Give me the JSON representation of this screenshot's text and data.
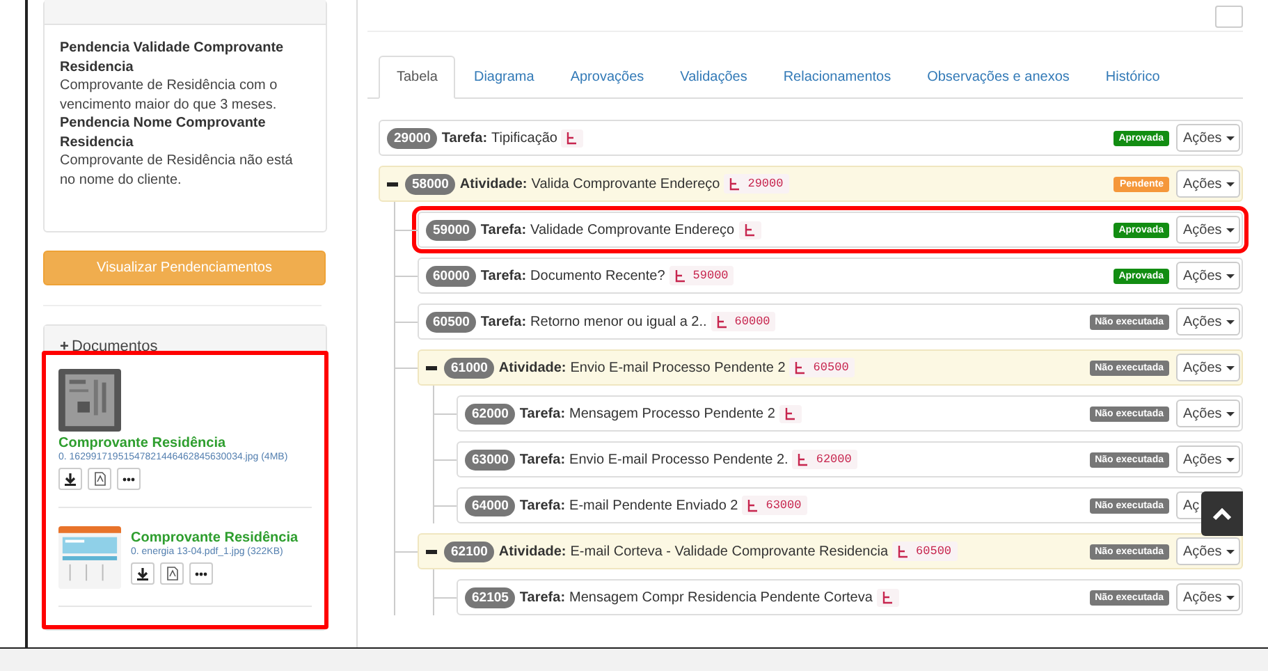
{
  "pendencias": {
    "items": [
      {
        "title": "Pendencia Validade Comprovante Residencia",
        "text": "Comprovante de Residência com o vencimento maior do que 3 meses."
      },
      {
        "title": "Pendencia Nome Comprovante Residencia",
        "text": "Comprovante de Residência não está no nome do cliente."
      }
    ],
    "button": "Visualizar Pendenciamentos"
  },
  "documentos": {
    "toggle": "+",
    "title": "Documentos",
    "highlighted": true,
    "items": [
      {
        "kind": "picture",
        "title": "Comprovante Residência",
        "file": "0. 16299171951547821446462845630034.jpg (4MB)"
      },
      {
        "kind": "picture",
        "title": "Comprovante Residência",
        "file": "0. energia 13-04.pdf_1.jpg (322KB)"
      }
    ]
  },
  "tabs": [
    {
      "label": "Tabela",
      "selected": true
    },
    {
      "label": "Diagrama",
      "selected": false
    },
    {
      "label": "Aprovações",
      "selected": false
    },
    {
      "label": "Validações",
      "selected": false
    },
    {
      "label": "Relacionamentos",
      "selected": false
    },
    {
      "label": "Observações e anexos",
      "selected": false
    },
    {
      "label": "Histórico",
      "selected": false
    }
  ],
  "tree": [
    {
      "kind": "task",
      "id": "29000",
      "type": "Tarefa:",
      "name": "Tipificação",
      "status": "Aprovada",
      "color": "#128d12",
      "actions": "Ações"
    },
    {
      "kind": "activity",
      "id": "58000",
      "type": "Atividade:",
      "name": "Valida Comprovante Endereço",
      "dep": "29000",
      "status": "Pendente",
      "color": "#f5973a",
      "actions": "Ações",
      "expanded": true,
      "children": [
        {
          "kind": "task",
          "id": "59000",
          "type": "Tarefa:",
          "name": "Validade Comprovante Endereço",
          "status": "Aprovada",
          "color": "#128d12",
          "actions": "Ações",
          "highlighted": true
        },
        {
          "kind": "task",
          "id": "60000",
          "type": "Tarefa:",
          "name": "Documento Recente?",
          "dep": "59000",
          "status": "Aprovada",
          "color": "#128d12",
          "actions": "Ações"
        },
        {
          "kind": "task",
          "id": "60500",
          "type": "Tarefa:",
          "name": "Retorno menor ou igual a 2..",
          "dep": "60000",
          "status": "Não executada",
          "color": "#777777",
          "actions": "Ações"
        },
        {
          "kind": "activity",
          "id": "61000",
          "type": "Atividade:",
          "name": "Envio E-mail Processo Pendente 2",
          "dep": "60500",
          "status": "Não executada",
          "color": "#777777",
          "actions": "Ações",
          "expanded": true,
          "children": [
            {
              "kind": "task",
              "id": "62000",
              "type": "Tarefa:",
              "name": "Mensagem Processo Pendente 2",
              "status": "Não executada",
              "color": "#777777",
              "actions": "Ações"
            },
            {
              "kind": "task",
              "id": "63000",
              "type": "Tarefa:",
              "name": "Envio E-mail Processo Pendente 2.",
              "dep": "62000",
              "status": "Não executada",
              "color": "#777777",
              "actions": "Ações"
            },
            {
              "kind": "task",
              "id": "64000",
              "type": "Tarefa:",
              "name": "E-mail Pendente Enviado 2",
              "dep": "63000",
              "status": "Não executada",
              "color": "#777777",
              "actions": "Aç",
              "caret": false
            }
          ]
        },
        {
          "kind": "activity",
          "id": "62100",
          "type": "Atividade:",
          "name": "E-mail Corteva - Validade Comprovante Residencia",
          "dep": "60500",
          "status": "Não executada",
          "color": "#777777",
          "actions": "Ações",
          "expanded": true,
          "children": [
            {
              "kind": "task",
              "id": "62105",
              "type": "Tarefa:",
              "name": "Mensagem Compr Residencia Pendente Corteva",
              "status": "Não executada",
              "color": "#777777",
              "actions": "Ações"
            }
          ]
        }
      ]
    }
  ]
}
